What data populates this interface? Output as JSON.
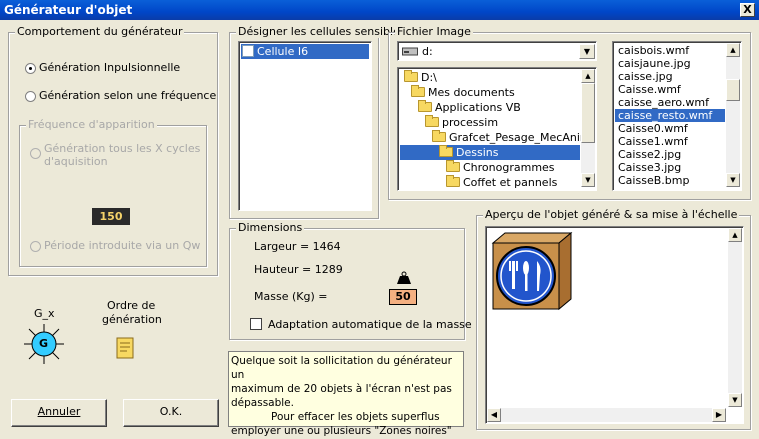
{
  "window": {
    "title": "Générateur d'objet",
    "close_label": "X"
  },
  "behaviour": {
    "legend": "Comportement du générateur",
    "option_impulse": "Génération Inpulsionnelle",
    "option_frequency": "Génération selon une fréquence",
    "selected": "impulse",
    "freq_group": {
      "legend": "Fréquence d'apparition",
      "option_cycles_line1": "Génération tous les X cycles",
      "option_cycles_line2": "d'aquisition",
      "cycles_value": "150",
      "option_qw": "Période introduite via un Qw"
    }
  },
  "icons": {
    "gx_label": "G_x",
    "gx_letter": "G",
    "order_label_line1": "Ordre de",
    "order_label_line2": "génération"
  },
  "buttons": {
    "cancel": "Annuler",
    "ok": "O.K."
  },
  "cells": {
    "legend": "Désigner les cellules sensibles",
    "items": [
      {
        "label": "Cellule I6",
        "checked": false,
        "selected": true
      }
    ]
  },
  "dimensions": {
    "legend": "Dimensions",
    "width_text": "Largeur = 1464",
    "height_text": "Hauteur = 1289",
    "mass_label": "Masse (Kg) =",
    "mass_value": "50",
    "auto_mass_label": "Adaptation automatique de la masse",
    "auto_mass_checked": false
  },
  "info": {
    "line1": "Quelque soit la sollicitation du générateur un",
    "line2": "maximum de 20 objets à l'écran n'est pas",
    "line3": "dépassable.",
    "line4": "Pour effacer les objets superflus",
    "line5": "employer une ou plusieurs \"Zones noires\""
  },
  "file": {
    "legend": "Fichier Image",
    "drive": "d:",
    "tree": [
      {
        "label": "D:\\",
        "indent": 0,
        "selected": false
      },
      {
        "label": "Mes documents",
        "indent": 1,
        "selected": false
      },
      {
        "label": "Applications VB",
        "indent": 2,
        "selected": false
      },
      {
        "label": "processim",
        "indent": 3,
        "selected": false
      },
      {
        "label": "Grafcet_Pesage_MecAnim",
        "indent": 4,
        "selected": false
      },
      {
        "label": "Dessins",
        "indent": 5,
        "selected": true
      },
      {
        "label": "Chronogrammes",
        "indent": 6,
        "selected": false
      },
      {
        "label": "Coffet et pannels",
        "indent": 6,
        "selected": false
      }
    ],
    "files": [
      {
        "label": "caisbois.wmf",
        "selected": false
      },
      {
        "label": "caisjaune.jpg",
        "selected": false
      },
      {
        "label": "caisse.jpg",
        "selected": false
      },
      {
        "label": "Caisse.wmf",
        "selected": false
      },
      {
        "label": "caisse_aero.wmf",
        "selected": false
      },
      {
        "label": "caisse_resto.wmf",
        "selected": true
      },
      {
        "label": "Caisse0.wmf",
        "selected": false
      },
      {
        "label": "Caisse1.wmf",
        "selected": false
      },
      {
        "label": "Caisse2.jpg",
        "selected": false
      },
      {
        "label": "Caisse3.jpg",
        "selected": false
      },
      {
        "label": "CaisseB.bmp",
        "selected": false
      }
    ]
  },
  "preview": {
    "legend": "Aperçu de l'objet généré & sa mise à l'échelle"
  },
  "colors": {
    "selection": "#316AC5",
    "info_bg": "#FFFFE0",
    "preview_blue": "#2255CC",
    "box_brown": "#C8904A"
  }
}
